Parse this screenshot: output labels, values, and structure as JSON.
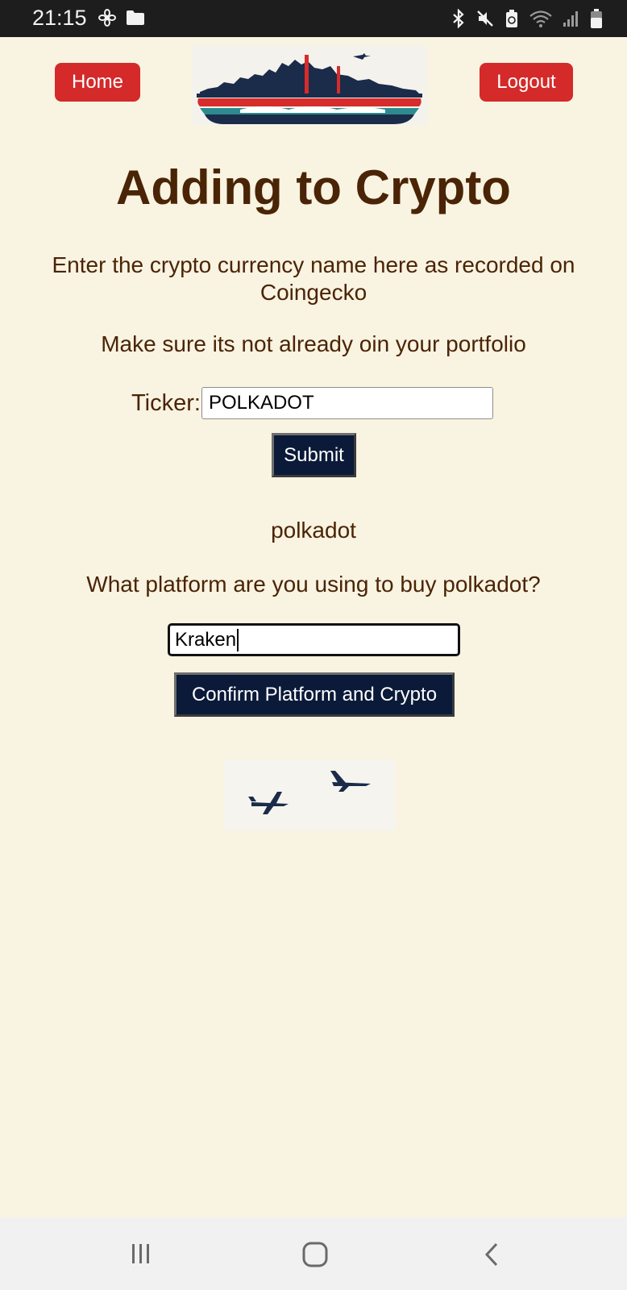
{
  "status_bar": {
    "time": "21:15",
    "left_icons": [
      "fan-icon",
      "folder-icon"
    ],
    "right_icons": [
      "bluetooth-icon",
      "mute-icon",
      "battery-saver-icon",
      "wifi-icon",
      "signal-icon",
      "battery-icon"
    ]
  },
  "header": {
    "home_label": "Home",
    "logout_label": "Logout",
    "logo": "city-skyline-logo"
  },
  "main": {
    "title": "Adding to Crypto",
    "intro_text": "Enter the crypto currency name here as recorded on Coingecko",
    "warning_text": "Make sure its not already oin your portfolio",
    "ticker_label": "Ticker:",
    "ticker_value": "POLKADOT",
    "submit_label": "Submit",
    "coin_name": "polkadot",
    "platform_question": "What platform are you using to buy polkadot?",
    "platform_value": "Kraken",
    "confirm_label": "Confirm Platform and Crypto",
    "decor_image": "two-airplanes-image"
  },
  "nav_bar": {
    "icons": [
      "recent-apps-icon",
      "home-icon",
      "back-icon"
    ]
  },
  "colors": {
    "background": "#f9f3e1",
    "text": "#4a2406",
    "nav_button": "#d42a2a",
    "dark_button": "#0b1a39"
  }
}
